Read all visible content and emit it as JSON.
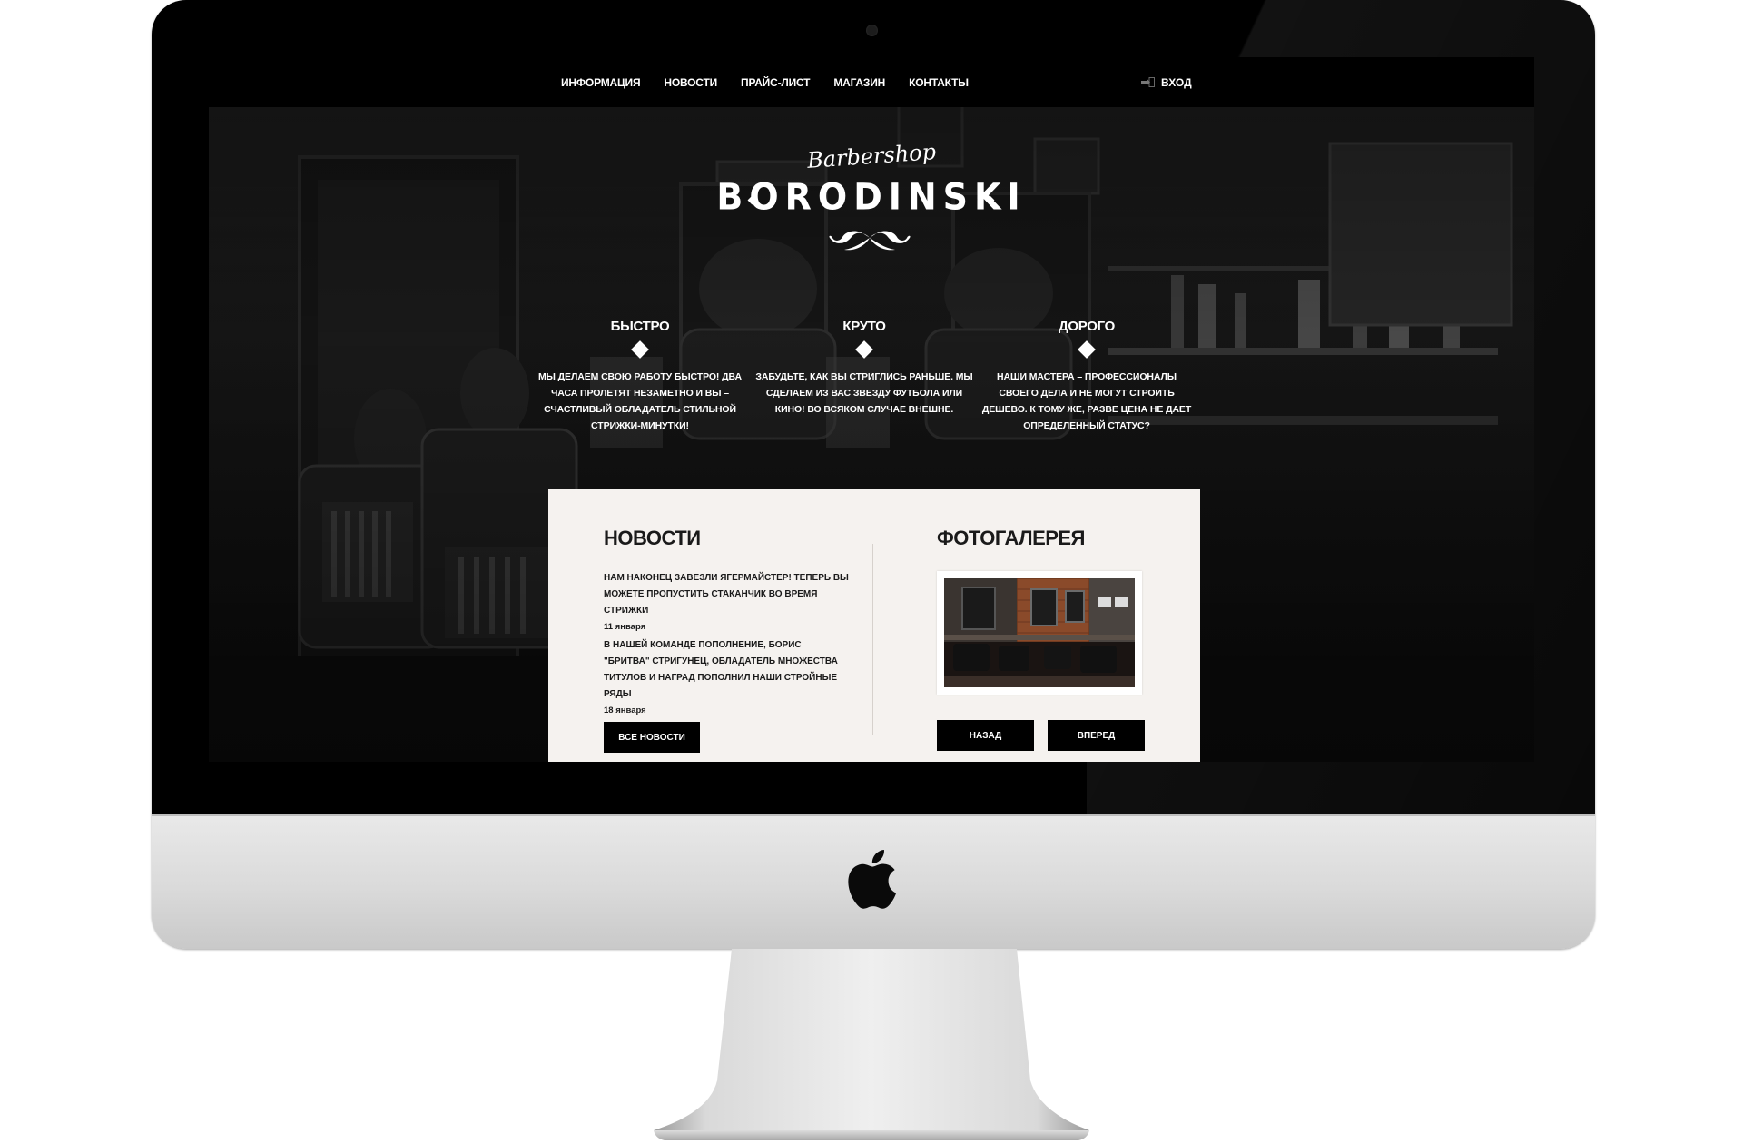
{
  "nav": {
    "items": [
      "ИНФОРМАЦИЯ",
      "НОВОСТИ",
      "ПРАЙС-ЛИСТ",
      "МАГАЗИН",
      "КОНТАКТЫ"
    ],
    "login_label": "ВХОД",
    "login_icon": "sign-in-icon"
  },
  "logo": {
    "script": "Barbershop",
    "main": "BORODINSKI",
    "icon": "mustache-icon"
  },
  "features": [
    {
      "title": "БЫСТРО",
      "text": "МЫ ДЕЛАЕМ СВОЮ РАБОТУ БЫСТРО! ДВА ЧАСА ПРОЛЕТЯТ НЕЗАМЕТНО И ВЫ – СЧАСТЛИВЫЙ ОБЛАДАТЕЛЬ СТИЛЬНОЙ СТРИЖКИ-МИНУТКИ!"
    },
    {
      "title": "КРУТО",
      "text": "ЗАБУДЬТЕ, КАК ВЫ СТРИГЛИСЬ РАНЬШЕ. МЫ СДЕЛАЕМ ИЗ ВАС ЗВЕЗДУ ФУТБОЛА ИЛИ КИНО! ВО ВСЯКОМ СЛУЧАЕ ВНЕШНЕ."
    },
    {
      "title": "ДОРОГО",
      "text": "НАШИ МАСТЕРА – ПРОФЕССИОНАЛЫ СВОЕГО ДЕЛА И НЕ МОГУТ СТРОИТЬ ДЕШЕВО. К ТОМУ ЖЕ, РАЗВЕ ЦЕНА НЕ ДАЕТ ОПРЕДЕЛЕННЫЙ СТАТУС?"
    }
  ],
  "news": {
    "title": "НОВОСТИ",
    "items": [
      {
        "text": "НАМ НАКОНЕЦ ЗАВЕЗЛИ ЯГЕРМАЙСТЕР! ТЕПЕРЬ ВЫ МОЖЕТЕ ПРОПУСТИТЬ СТАКАНЧИК ВО ВРЕМЯ СТРИЖКИ",
        "date": "11 января"
      },
      {
        "text": "В НАШЕЙ КОМАНДЕ ПОПОЛНЕНИЕ, БОРИС \"БРИТВА\" СТРИГУНЕЦ, ОБЛАДАТЕЛЬ МНОЖЕСТВА ТИТУЛОВ И НАГРАД ПОПОЛНИЛ НАШИ СТРОЙНЫЕ РЯДЫ",
        "date": "18 января"
      }
    ],
    "all_button": "ВСЕ НОВОСТИ"
  },
  "gallery": {
    "title": "ФОТОГАЛЕРЕЯ",
    "back_button": "НАЗАД",
    "next_button": "ВПЕРЕД"
  },
  "colors": {
    "topbar": "#000000",
    "panel": "#f5f2ef",
    "button": "#000000",
    "text_light": "#ffffff",
    "text_dark": "#1a1a1a"
  }
}
